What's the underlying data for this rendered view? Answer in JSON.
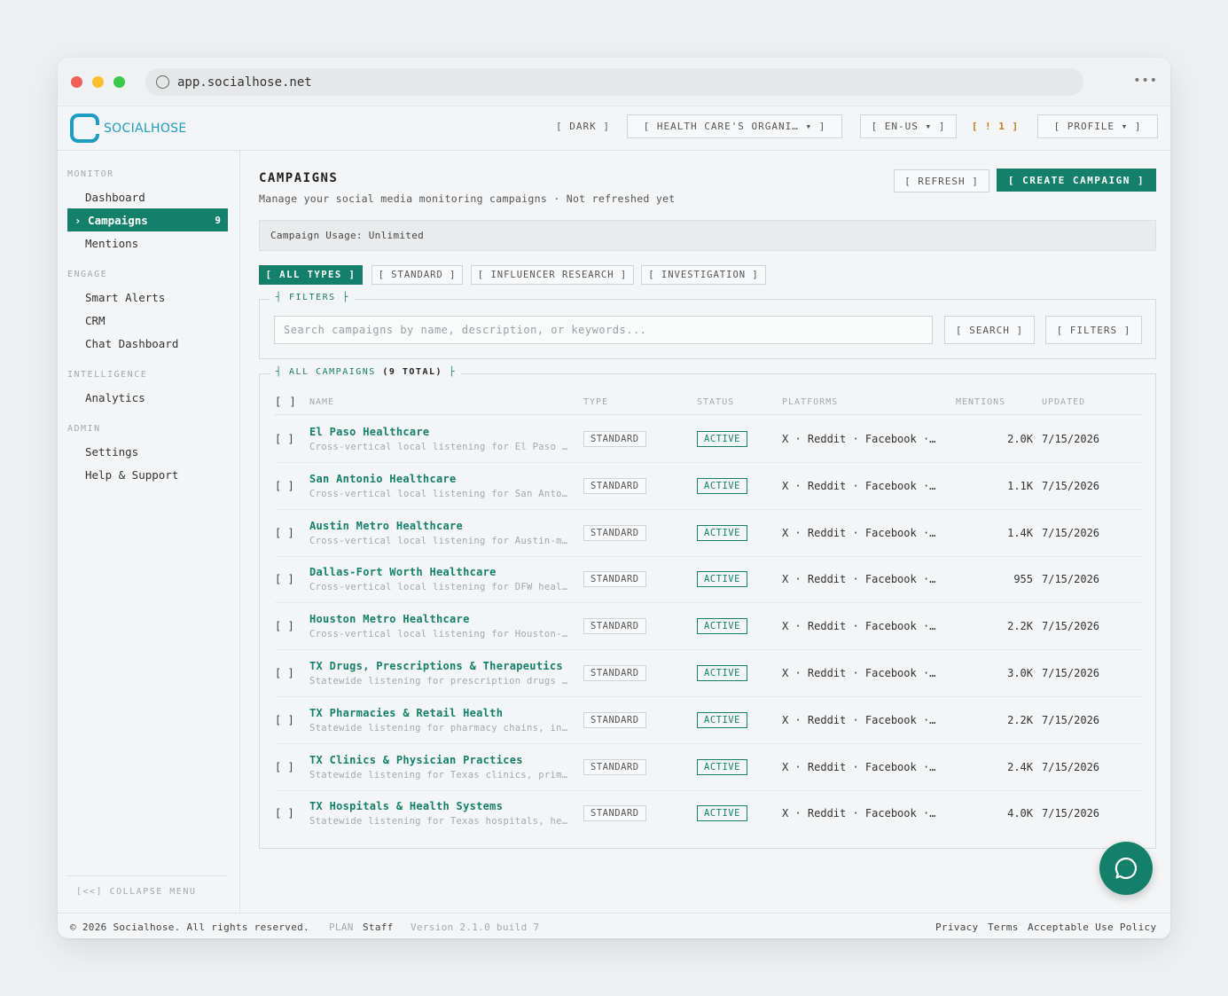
{
  "browser": {
    "url": "app.socialhose.net",
    "more_icon": "more-horizontal-icon"
  },
  "header": {
    "logo_text": "SOCIALHOSE",
    "theme_button": "[ DARK ]",
    "org_select": "[ HEALTH CARE'S ORGANI… ▾ ]",
    "lang_select": "[ EN-US ▾ ]",
    "alerts": "[ ! 1 ]",
    "profile": "[ PROFILE ▾ ]"
  },
  "sidebar": {
    "groups": [
      {
        "label": "MONITOR"
      },
      {
        "label": "ENGAGE"
      },
      {
        "label": "INTELLIGENCE"
      },
      {
        "label": "ADMIN"
      }
    ],
    "items": [
      {
        "label": "Dashboard"
      },
      {
        "label": "› Campaigns",
        "badge": "9"
      },
      {
        "label": "Mentions"
      },
      {
        "label": "Smart Alerts"
      },
      {
        "label": "CRM"
      },
      {
        "label": "Chat Dashboard"
      },
      {
        "label": "Analytics"
      },
      {
        "label": "Settings"
      },
      {
        "label": "Help & Support"
      }
    ],
    "collapse_label": "[<<] COLLAPSE MENU"
  },
  "main": {
    "title": "CAMPAIGNS",
    "subtitle": "Manage your social media monitoring campaigns · Not refreshed yet",
    "refresh_label": "[ REFRESH ]",
    "create_label": "[ CREATE CAMPAIGN ]",
    "usage": "Campaign Usage: Unlimited",
    "tabs": [
      "[ ALL TYPES ]",
      "[ STANDARD ]",
      "[ INFLUENCER RESEARCH ]",
      "[ INVESTIGATION ]"
    ],
    "filters": {
      "legend": "┤ FILTERS ├",
      "placeholder": "Search campaigns by name, description, or keywords...",
      "search_label": "[ SEARCH ]",
      "filters_label": "[ FILTERS ]"
    },
    "table": {
      "legend_prefix": "┤ ALL CAMPAIGNS ",
      "legend_total": "(9 TOTAL)",
      "legend_suffix": " ├",
      "columns": {
        "select": "[ ]",
        "name": "NAME",
        "type": "TYPE",
        "status": "STATUS",
        "platforms": "PLATFORMS",
        "mentions": "MENTIONS",
        "updated": "UPDATED"
      },
      "rows": [
        {
          "check": "[ ]",
          "name": "El Paso Healthcare",
          "desc": "Cross-vertical local listening for El Paso region",
          "type": "STANDARD",
          "status": "ACTIVE",
          "platforms": "X · Reddit · Facebook ·…",
          "mentions": "2.0K",
          "updated": "7/15/2026"
        },
        {
          "check": "[ ]",
          "name": "San Antonio Healthcare",
          "desc": "Cross-vertical local listening for San Antonio region",
          "type": "STANDARD",
          "status": "ACTIVE",
          "platforms": "X · Reddit · Facebook ·…",
          "mentions": "1.1K",
          "updated": "7/15/2026"
        },
        {
          "check": "[ ]",
          "name": "Austin Metro Healthcare",
          "desc": "Cross-vertical local listening for Austin-metro region",
          "type": "STANDARD",
          "status": "ACTIVE",
          "platforms": "X · Reddit · Facebook ·…",
          "mentions": "1.4K",
          "updated": "7/15/2026"
        },
        {
          "check": "[ ]",
          "name": "Dallas-Fort Worth Healthcare",
          "desc": "Cross-vertical local listening for DFW healthcare",
          "type": "STANDARD",
          "status": "ACTIVE",
          "platforms": "X · Reddit · Facebook ·…",
          "mentions": "955",
          "updated": "7/15/2026"
        },
        {
          "check": "[ ]",
          "name": "Houston Metro Healthcare",
          "desc": "Cross-vertical local listening for Houston-metro region",
          "type": "STANDARD",
          "status": "ACTIVE",
          "platforms": "X · Reddit · Facebook ·…",
          "mentions": "2.2K",
          "updated": "7/15/2026"
        },
        {
          "check": "[ ]",
          "name": "TX Drugs, Prescriptions & Therapeutics",
          "desc": "Statewide listening for prescription drugs and therapeutics",
          "type": "STANDARD",
          "status": "ACTIVE",
          "platforms": "X · Reddit · Facebook ·…",
          "mentions": "3.0K",
          "updated": "7/15/2026"
        },
        {
          "check": "[ ]",
          "name": "TX Pharmacies & Retail Health",
          "desc": "Statewide listening for pharmacy chains, independents",
          "type": "STANDARD",
          "status": "ACTIVE",
          "platforms": "X · Reddit · Facebook ·…",
          "mentions": "2.2K",
          "updated": "7/15/2026"
        },
        {
          "check": "[ ]",
          "name": "TX Clinics & Physician Practices",
          "desc": "Statewide listening for Texas clinics, primary care",
          "type": "STANDARD",
          "status": "ACTIVE",
          "platforms": "X · Reddit · Facebook ·…",
          "mentions": "2.4K",
          "updated": "7/15/2026"
        },
        {
          "check": "[ ]",
          "name": "TX Hospitals & Health Systems",
          "desc": "Statewide listening for Texas hospitals, health systems",
          "type": "STANDARD",
          "status": "ACTIVE",
          "platforms": "X · Reddit · Facebook ·…",
          "mentions": "4.0K",
          "updated": "7/15/2026"
        }
      ]
    }
  },
  "footer": {
    "copyright": "© 2026 Socialhose. All rights reserved.",
    "plan_label": "PLAN",
    "plan_value": "Staff",
    "version": "Version 2.1.0 build 7",
    "links": [
      "Privacy",
      "Terms",
      "Acceptable Use Policy"
    ]
  },
  "colors": {
    "accent": "#14806a",
    "logo": "#1f9cc4",
    "alert": "#c77a1a"
  }
}
